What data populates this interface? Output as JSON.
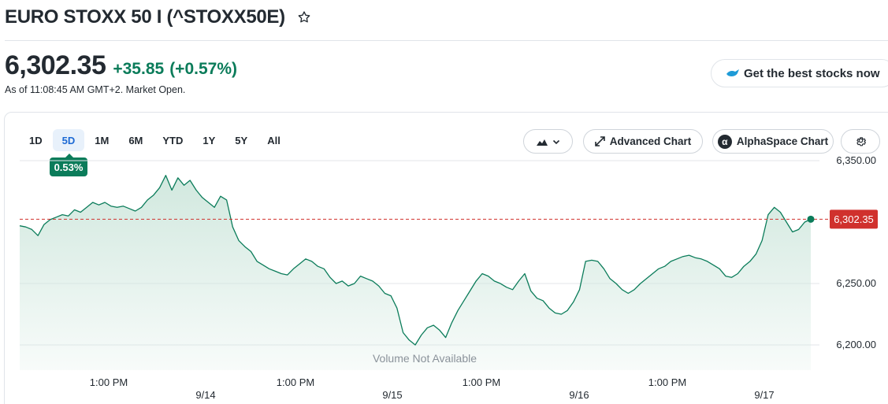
{
  "header": {
    "title": "EURO STOXX 50 I (^STOXX50E)",
    "star_icon": "star-outline-icon"
  },
  "quote": {
    "price": "6,302.35",
    "change": "+35.85",
    "change_percent": "(+0.57%)",
    "as_of": "As of 11:08:45 AM GMT+2. Market Open.",
    "change_color": "#0b7c5a"
  },
  "promo": {
    "label": "Get the best stocks now",
    "icon": "bird-icon"
  },
  "toolbar": {
    "ranges": [
      "1D",
      "5D",
      "1M",
      "6M",
      "YTD",
      "1Y",
      "5Y",
      "All"
    ],
    "active_range": "5D",
    "range_change": "0.53%",
    "chart_type_icon": "mountain-chart-icon",
    "advanced_chart_label": "Advanced Chart",
    "alphaspace_label": "AlphaSpace Chart",
    "alphaspace_glyph": "α",
    "settings_icon": "gear-icon"
  },
  "chart_data": {
    "type": "area",
    "y_ticks": [
      "6,350.00",
      "6,250.00",
      "6,200.00"
    ],
    "x_labels": [
      "1:00 PM",
      "9/14",
      "1:00 PM",
      "9/15",
      "1:00 PM",
      "9/16",
      "1:00 PM",
      "9/17"
    ],
    "current_value_label": "6,302.35",
    "current_value": 6302.35,
    "volume_note": "Volume Not Available",
    "grid": true,
    "colors": {
      "line": "#0b7c5a",
      "fill": "#d7ede4",
      "ref_line": "#d0312d",
      "badge": "#d0312d"
    },
    "series": [
      {
        "values": [
          6297,
          6296,
          6294,
          6289,
          6298,
          6302,
          6304,
          6306,
          6305,
          6310,
          6308,
          6312,
          6316,
          6314,
          6316,
          6313,
          6312,
          6313,
          6311,
          6309,
          6312,
          6318,
          6322,
          6328,
          6338,
          6326,
          6336,
          6330,
          6334,
          6326,
          6320,
          6316,
          6312,
          6321,
          6318,
          6296,
          6285,
          6280,
          6276,
          6268,
          6265,
          6262,
          6260,
          6258,
          6257,
          6262,
          6266,
          6270,
          6268,
          6264,
          6262,
          6255,
          6250,
          6252,
          6248,
          6250,
          6256,
          6254,
          6252,
          6248,
          6242,
          6240,
          6230,
          6210,
          6204,
          6200,
          6208,
          6214,
          6216,
          6212,
          6206,
          6218,
          6228,
          6236,
          6244,
          6252,
          6258,
          6256,
          6252,
          6250,
          6247,
          6245,
          6252,
          6258,
          6244,
          6238,
          6236,
          6230,
          6226,
          6225,
          6228,
          6235,
          6245,
          6268,
          6269,
          6268,
          6262,
          6254,
          6250,
          6245,
          6242,
          6245,
          6250,
          6254,
          6258,
          6262,
          6264,
          6268,
          6270,
          6272,
          6273,
          6271,
          6270,
          6268,
          6265,
          6262,
          6256,
          6255,
          6258,
          6264,
          6268,
          6274,
          6285,
          6306,
          6312,
          6308,
          6300,
          6292,
          6294,
          6300,
          6302.35
        ]
      }
    ]
  }
}
